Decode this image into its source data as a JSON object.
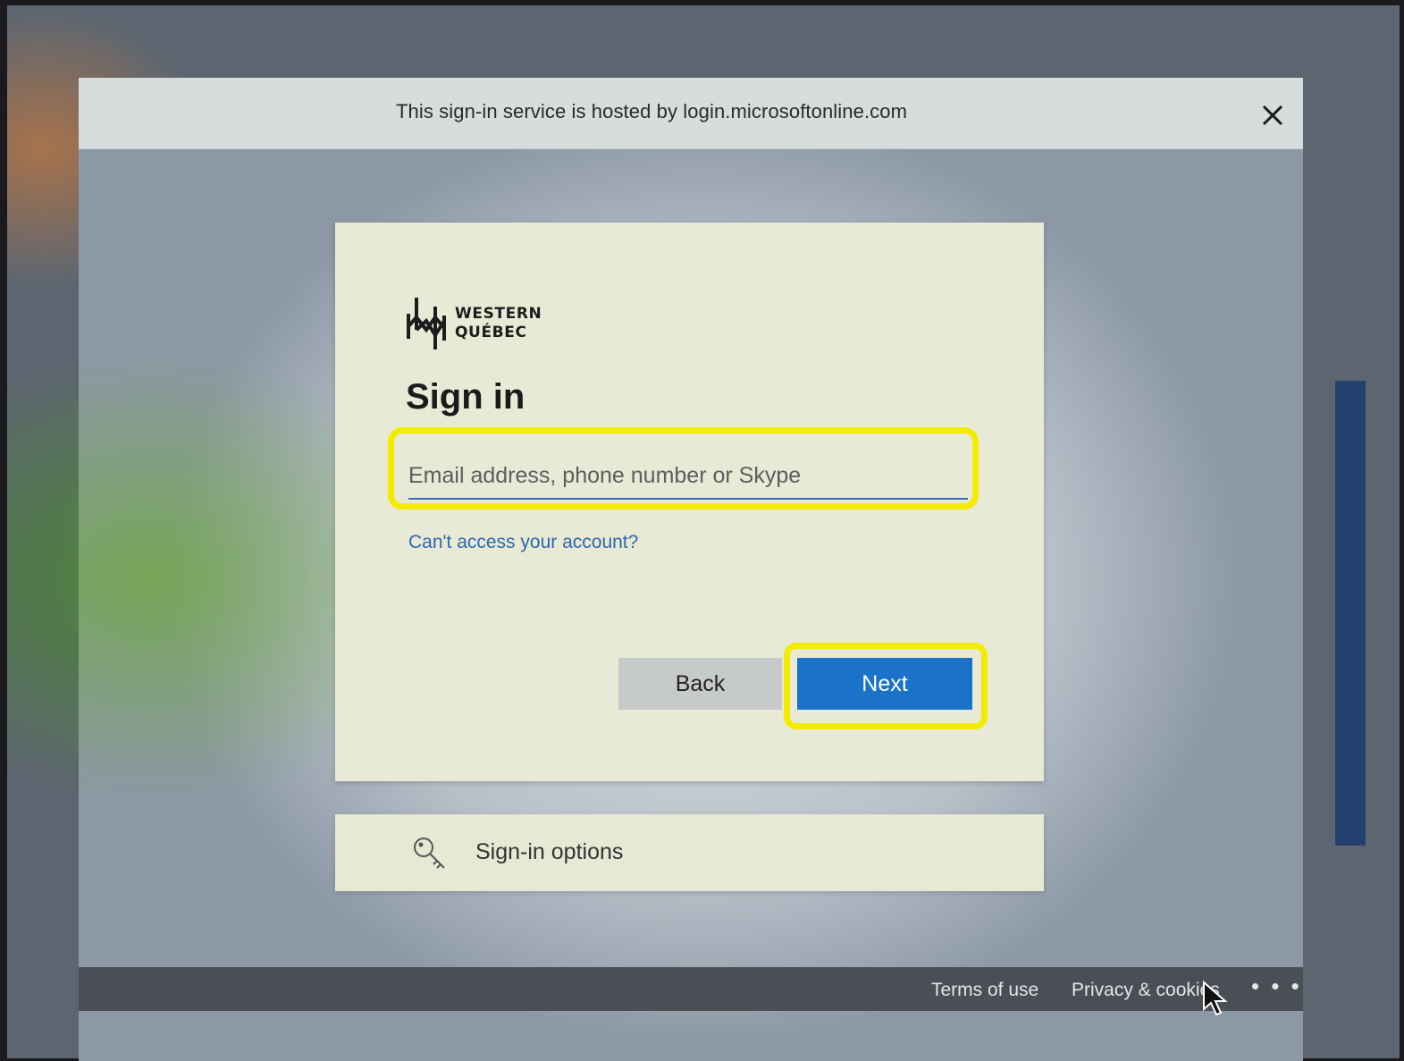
{
  "host_bar": {
    "text": "This sign-in service is hosted by login.microsoftonline.com",
    "close_label": "×"
  },
  "logo": {
    "line1": "WESTERN",
    "line2": "QUÉBEC"
  },
  "sign_in": {
    "title": "Sign in",
    "email_placeholder": "Email address, phone number or Skype",
    "email_value": "",
    "cant_access_link": "Can't access your account?",
    "back_label": "Back",
    "next_label": "Next"
  },
  "options": {
    "label": "Sign-in options",
    "icon": "key-icon"
  },
  "footer": {
    "terms": "Terms of use",
    "privacy": "Privacy & cookies",
    "more": "• • •"
  },
  "colors": {
    "accent": "#1a73c9",
    "link": "#2c67b3",
    "highlight": "#f4ec00",
    "card": "#e9ead6",
    "footer": "#4a4f55"
  }
}
